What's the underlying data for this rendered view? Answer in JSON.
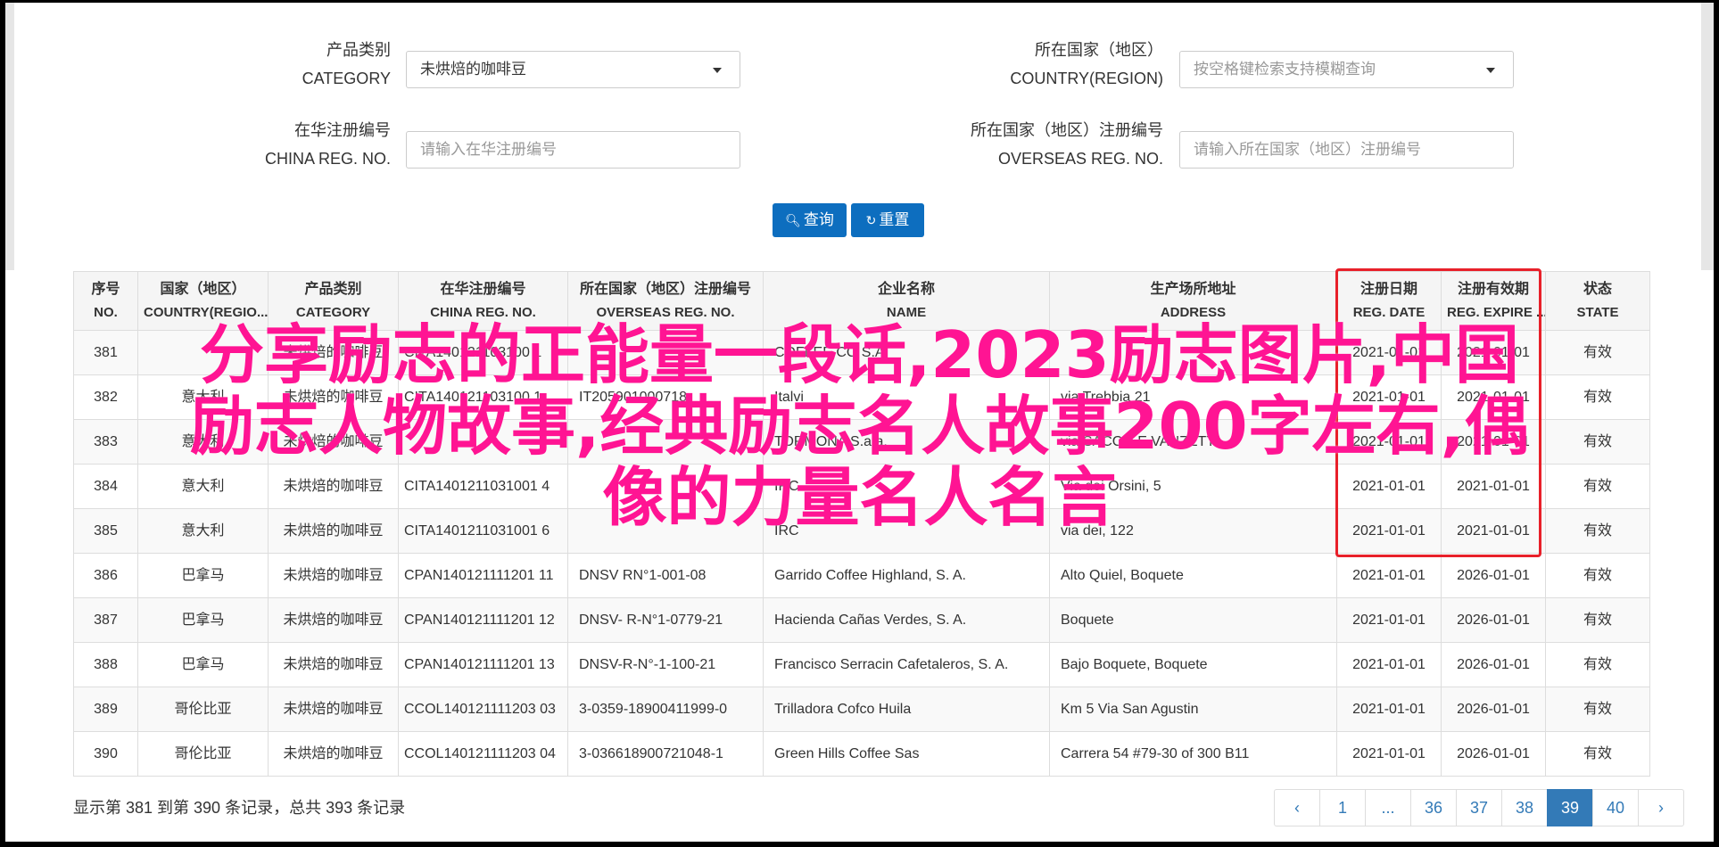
{
  "form": {
    "category": {
      "label_cn": "产品类别",
      "label_en": "CATEGORY",
      "value": "未烘焙的咖啡豆"
    },
    "country": {
      "label_cn": "所在国家（地区）",
      "label_en": "COUNTRY(REGION)",
      "placeholder": "按空格键检索支持模糊查询"
    },
    "china_reg": {
      "label_cn": "在华注册编号",
      "label_en": "CHINA REG. NO.",
      "placeholder": "请输入在华注册编号"
    },
    "overseas_reg": {
      "label_cn": "所在国家（地区）注册编号",
      "label_en": "OVERSEAS REG. NO.",
      "placeholder": "请输入所在国家（地区）注册编号"
    },
    "search_label": "查询",
    "reset_label": "重置"
  },
  "table": {
    "columns": [
      {
        "cn": "序号",
        "en": "NO."
      },
      {
        "cn": "国家（地区）",
        "en": "COUNTRY(REGIO..."
      },
      {
        "cn": "产品类别",
        "en": "CATEGORY"
      },
      {
        "cn": "在华注册编号",
        "en": "CHINA REG. NO."
      },
      {
        "cn": "所在国家（地区）注册编号",
        "en": "OVERSEAS REG. NO."
      },
      {
        "cn": "企业名称",
        "en": "NAME"
      },
      {
        "cn": "生产场所地址",
        "en": "ADDRESS"
      },
      {
        "cn": "注册日期",
        "en": "REG. DATE"
      },
      {
        "cn": "注册有效期",
        "en": "REG. EXPIRE ..."
      },
      {
        "cn": "状态",
        "en": "STATE"
      }
    ],
    "rows": [
      [
        "381",
        "",
        "未烘焙的咖啡豆",
        "CITA140121103100 1",
        "",
        "COFFEE CO S.A.",
        "",
        "2021-01-01",
        "2021-01-01",
        "有效"
      ],
      [
        "382",
        "意大利",
        "未烘焙的咖啡豆",
        "CITA140121103100 1",
        "IT205901000718",
        "Italvi",
        "via Trebbia 21",
        "2021-01-01",
        "2021-01-01",
        "有效"
      ],
      [
        "383",
        "意大利",
        "未烘焙的咖啡豆",
        "",
        "",
        "TORMONA S.a.a.",
        "via SACCO E VANZETTI",
        "2021-01-01",
        "2021-01-01",
        "有效"
      ],
      [
        "384",
        "意大利",
        "未烘焙的咖啡豆",
        "CITA1401211031001 4",
        "",
        "IRC",
        "Via dei Orsini, 5",
        "2021-01-01",
        "2021-01-01",
        "有效"
      ],
      [
        "385",
        "意大利",
        "未烘焙的咖啡豆",
        "CITA1401211031001 6",
        "",
        "IRC",
        "via dei, 122",
        "2021-01-01",
        "2021-01-01",
        "有效"
      ],
      [
        "386",
        "巴拿马",
        "未烘焙的咖啡豆",
        "CPAN140121111201 11",
        "DNSV RN°1-001-08",
        "Garrido Coffee Highland, S. A.",
        "Alto Quiel, Boquete",
        "2021-01-01",
        "2026-01-01",
        "有效"
      ],
      [
        "387",
        "巴拿马",
        "未烘焙的咖啡豆",
        "CPAN140121111201 12",
        "DNSV- R-N°1-0779-21",
        "Hacienda Cañas Verdes, S. A.",
        "Boquete",
        "2021-01-01",
        "2026-01-01",
        "有效"
      ],
      [
        "388",
        "巴拿马",
        "未烘焙的咖啡豆",
        "CPAN140121111201 13",
        "DNSV-R-N°-1-100-21",
        "Francisco Serracin Cafetaleros, S. A.",
        "Bajo Boquete, Boquete",
        "2021-01-01",
        "2026-01-01",
        "有效"
      ],
      [
        "389",
        "哥伦比亚",
        "未烘焙的咖啡豆",
        "CCOL140121111203 03",
        "3-0359-18900411999-0",
        "Trilladora Cofco Huila",
        "Km 5 Via San Agustin",
        "2021-01-01",
        "2026-01-01",
        "有效"
      ],
      [
        "390",
        "哥伦比亚",
        "未烘焙的咖啡豆",
        "CCOL140121111203 04",
        "3-03661890072104‌8-1",
        "Green Hills Coffee Sas",
        "Carrera 54 #79-30 of 300 B11",
        "2021-01-01",
        "2026-01-01",
        "有效"
      ]
    ]
  },
  "overlay": {
    "line1": "分享励志的正能量一段话,2023励志图片,中国",
    "line2": "励志人物故事,经典励志名人故事200字左右,偶",
    "line3": "像的力量名人名言"
  },
  "summary": "显示第 381 到第 390 条记录，总共 393 条记录",
  "pagination": [
    "‹",
    "1",
    "...",
    "36",
    "37",
    "38",
    "39",
    "40",
    "›"
  ],
  "pagination_active": "39",
  "colors": {
    "primary": "#0d6ebf",
    "pager_active": "#337ab7",
    "highlight_box": "#e8202a",
    "overlay_text": "#ff1493"
  }
}
